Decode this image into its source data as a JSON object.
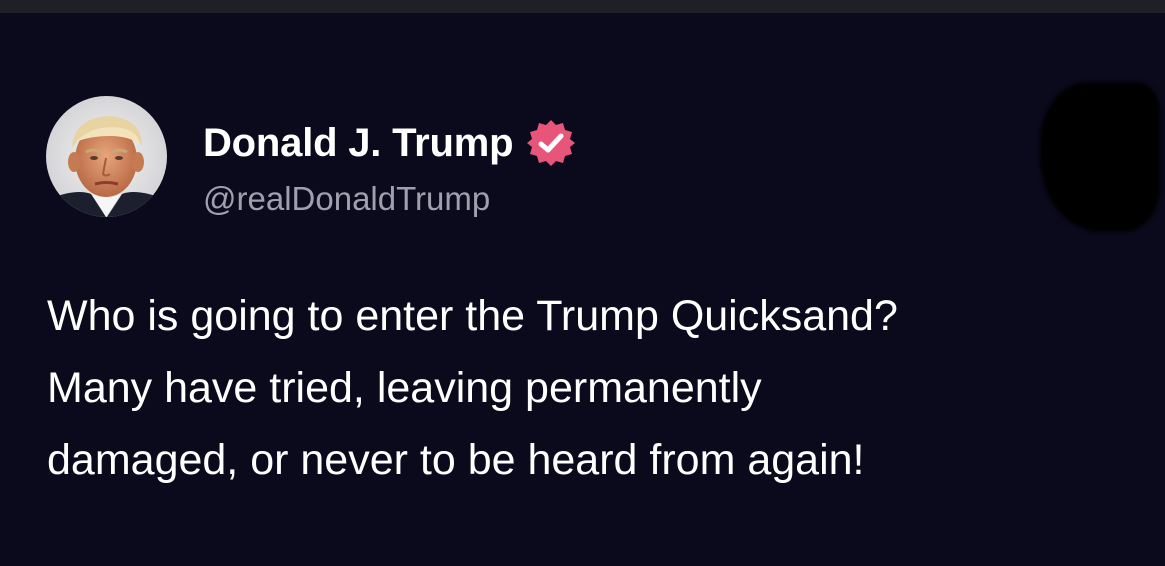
{
  "post": {
    "author": {
      "display_name": "Donald J. Trump",
      "handle": "@realDonaldTrump",
      "avatar_icon": "profile-photo",
      "verified_icon": "verified-badge-icon",
      "verified_color": "#e8557a"
    },
    "text_lines": [
      "Who is going to enter the Trump Quicksand?",
      "Many have tried, leaving permanently",
      "damaged, or never to be heard from again!"
    ]
  },
  "colors": {
    "background": "#0b0a1c",
    "topbar": "#1f1f27",
    "text_primary": "#ffffff",
    "text_secondary": "#9f9fae"
  }
}
